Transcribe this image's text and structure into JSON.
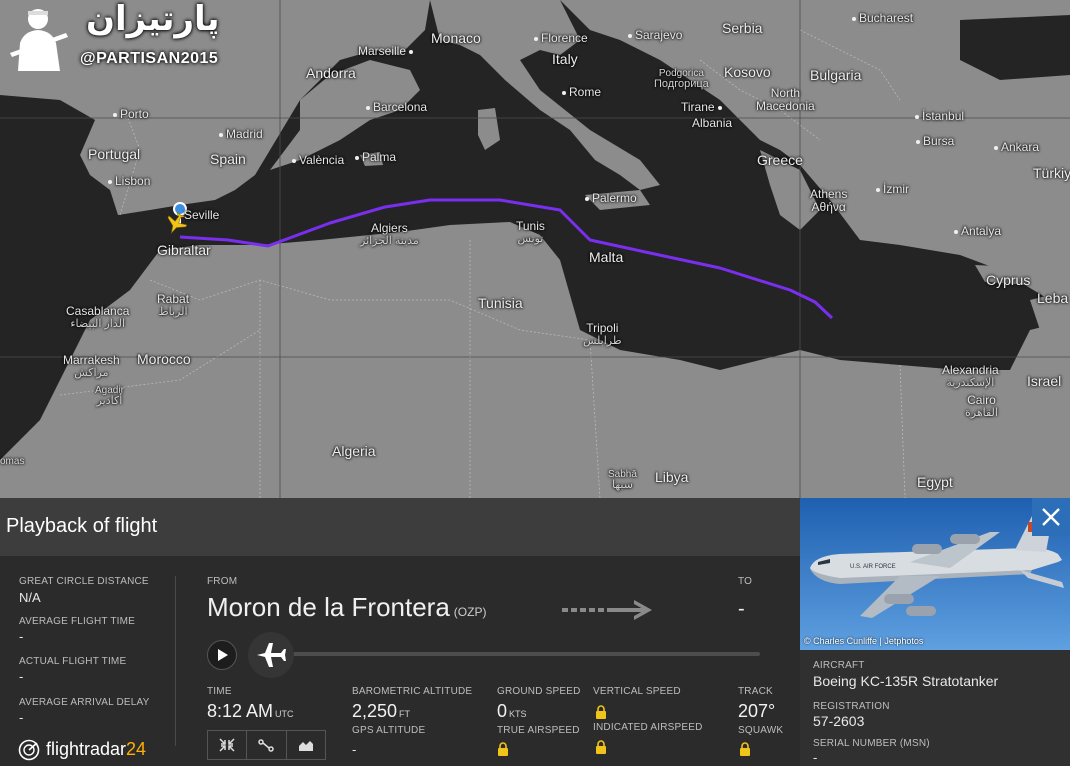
{
  "watermark": {
    "logo_text": "پارتیزان",
    "handle": "@PARTISAN2015"
  },
  "map": {
    "places": [
      {
        "id": "bucharest",
        "label": "Bucharest"
      },
      {
        "id": "sarajevo",
        "label": "Sarajevo"
      },
      {
        "id": "serbia",
        "label": "Serbia"
      },
      {
        "id": "monaco",
        "label": "Monaco"
      },
      {
        "id": "florence",
        "label": "Florence"
      },
      {
        "id": "marseille",
        "label": "Marseille"
      },
      {
        "id": "andorra",
        "label": "Andorra"
      },
      {
        "id": "italy",
        "label": "Italy"
      },
      {
        "id": "podgorica",
        "label": "Podgorica",
        "sub": "Подгорица"
      },
      {
        "id": "kosovo",
        "label": "Kosovo"
      },
      {
        "id": "bulgaria",
        "label": "Bulgaria"
      },
      {
        "id": "barcelona",
        "label": "Barcelona"
      },
      {
        "id": "rome",
        "label": "Rome"
      },
      {
        "id": "tirane",
        "label": "Tirane"
      },
      {
        "id": "north_macedonia",
        "label": "North",
        "sub": "Macedonia"
      },
      {
        "id": "albania",
        "label": "Albania"
      },
      {
        "id": "istanbul",
        "label": "İstanbul"
      },
      {
        "id": "porto",
        "label": "Porto"
      },
      {
        "id": "madrid",
        "label": "Madrid"
      },
      {
        "id": "bursa",
        "label": "Bursa"
      },
      {
        "id": "ankara",
        "label": "Ankara"
      },
      {
        "id": "portugal",
        "label": "Portugal"
      },
      {
        "id": "spain",
        "label": "Spain"
      },
      {
        "id": "valencia",
        "label": "València"
      },
      {
        "id": "palma",
        "label": "Palma"
      },
      {
        "id": "greece",
        "label": "Greece"
      },
      {
        "id": "turkiye",
        "label": "Türkiye"
      },
      {
        "id": "lisbon",
        "label": "Lisbon"
      },
      {
        "id": "izmir",
        "label": "İzmir"
      },
      {
        "id": "athens",
        "label": "Athens",
        "sub": "Αθήνα"
      },
      {
        "id": "seville",
        "label": "Seville"
      },
      {
        "id": "palermo",
        "label": "Palermo"
      },
      {
        "id": "algiers",
        "label": "Algiers",
        "sub": "مدينة الجزائر"
      },
      {
        "id": "tunis",
        "label": "Tunis",
        "sub": "تونس"
      },
      {
        "id": "antalya",
        "label": "Antalya"
      },
      {
        "id": "gibraltar",
        "label": "Gibraltar"
      },
      {
        "id": "malta",
        "label": "Malta"
      },
      {
        "id": "cyprus",
        "label": "Cyprus"
      },
      {
        "id": "lebanon",
        "label": "Leba"
      },
      {
        "id": "casablanca",
        "label": "Casablanca",
        "sub": "الدار البيضاء"
      },
      {
        "id": "rabat",
        "label": "Rabat",
        "sub": "الرباط"
      },
      {
        "id": "tunisia",
        "label": "Tunisia"
      },
      {
        "id": "tripoli",
        "label": "Tripoli",
        "sub": "طرابلس"
      },
      {
        "id": "marrakesh",
        "label": "Marrakesh",
        "sub": "مراكش"
      },
      {
        "id": "morocco",
        "label": "Morocco"
      },
      {
        "id": "agadir",
        "label": "Agadir",
        "sub": "أكادير"
      },
      {
        "id": "alexandria",
        "label": "Alexandria",
        "sub": "الإسكندرية"
      },
      {
        "id": "israel",
        "label": "Israel"
      },
      {
        "id": "cairo",
        "label": "Cairo",
        "sub": "القاهرة"
      },
      {
        "id": "algeria",
        "label": "Algeria"
      },
      {
        "id": "sabha",
        "label": "Sabhā",
        "sub": "سبها"
      },
      {
        "id": "libya",
        "label": "Libya"
      },
      {
        "id": "egypt",
        "label": "Egypt"
      },
      {
        "id": "omas",
        "label": "omas"
      }
    ]
  },
  "panel": {
    "title": "Playback of flight",
    "great_circle_distance": {
      "label": "GREAT CIRCLE DISTANCE",
      "value": "N/A"
    },
    "average_flight_time": {
      "label": "AVERAGE FLIGHT TIME",
      "value": "-"
    },
    "actual_flight_time": {
      "label": "ACTUAL FLIGHT TIME",
      "value": "-"
    },
    "average_arrival_delay": {
      "label": "AVERAGE ARRIVAL DELAY",
      "value": "-"
    },
    "from": {
      "label": "FROM",
      "airport": "Moron de la Frontera",
      "code": "(OZP)"
    },
    "to": {
      "label": "TO",
      "value": "-"
    },
    "time": {
      "label": "TIME",
      "value": "8:12 AM",
      "unit": "UTC"
    },
    "barometric_altitude": {
      "label": "BAROMETRIC ALTITUDE",
      "value": "2,250",
      "unit": "FT"
    },
    "gps_altitude": {
      "label": "GPS ALTITUDE",
      "value": "-"
    },
    "ground_speed": {
      "label": "GROUND SPEED",
      "value": "0",
      "unit": "KTS"
    },
    "true_airspeed": {
      "label": "TRUE AIRSPEED"
    },
    "vertical_speed": {
      "label": "VERTICAL SPEED"
    },
    "indicated_airspeed": {
      "label": "INDICATED AIRSPEED"
    },
    "track": {
      "label": "TRACK",
      "value": "207°"
    },
    "squawk": {
      "label": "SQUAWK"
    },
    "brand": {
      "prefix": "flightradar",
      "suffix": "24"
    }
  },
  "aircraft": {
    "photo_credit": "© Charles Cunliffe | Jetphotos",
    "aircraft_label": "AIRCRAFT",
    "aircraft_value": "Boeing KC-135R Stratotanker",
    "registration_label": "REGISTRATION",
    "registration_value": "57-2603",
    "serial_label": "SERIAL NUMBER (MSN)",
    "serial_value": "-",
    "tail_text": "U.S. AIR FORCE"
  },
  "colors": {
    "flight_path": "#7a2ff0",
    "map_land": "#8f8f8f",
    "map_sea": "#232323",
    "close_button": "#2c6fb8",
    "brand_accent": "#ffb000"
  }
}
